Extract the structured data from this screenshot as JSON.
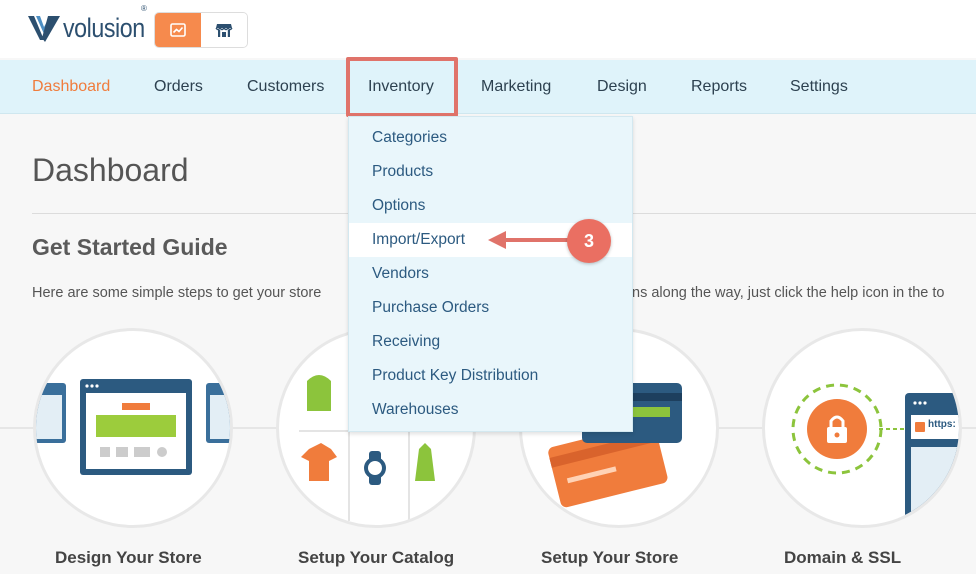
{
  "brand": {
    "name": "volusion",
    "trademark": "®"
  },
  "mode_switch": {
    "items": [
      {
        "icon": "chart-icon",
        "active": true
      },
      {
        "icon": "storefront-icon",
        "active": false
      }
    ]
  },
  "nav": {
    "items": [
      {
        "label": "Dashboard",
        "active": true
      },
      {
        "label": "Orders",
        "active": false
      },
      {
        "label": "Customers",
        "active": false
      },
      {
        "label": "Inventory",
        "active": false,
        "highlighted": true
      },
      {
        "label": "Marketing",
        "active": false
      },
      {
        "label": "Design",
        "active": false
      },
      {
        "label": "Reports",
        "active": false
      },
      {
        "label": "Settings",
        "active": false
      }
    ]
  },
  "inventory_menu": {
    "items": [
      {
        "label": "Categories"
      },
      {
        "label": "Products"
      },
      {
        "label": "Options"
      },
      {
        "label": "Import/Export",
        "hover": true
      },
      {
        "label": "Vendors"
      },
      {
        "label": "Purchase Orders"
      },
      {
        "label": "Receiving"
      },
      {
        "label": "Product Key Distribution"
      },
      {
        "label": "Warehouses"
      }
    ]
  },
  "callout": {
    "step_number": "3",
    "color": "#ea6f62"
  },
  "page": {
    "title": "Dashboard",
    "guide_title": "Get Started Guide",
    "guide_text_left": "Here are some simple steps to get your store",
    "guide_text_right": "ns along the way, just click the help icon in the to"
  },
  "steps": [
    {
      "label": "Design Your Store"
    },
    {
      "label": "Setup Your Catalog"
    },
    {
      "label": "Setup Your Store"
    },
    {
      "label": "Domain & SSL",
      "badge_text": "https:"
    }
  ],
  "colors": {
    "accent": "#f68a4d",
    "nav_bg": "#dff3fa",
    "link": "#2c5a80",
    "highlight": "#e0736a"
  }
}
